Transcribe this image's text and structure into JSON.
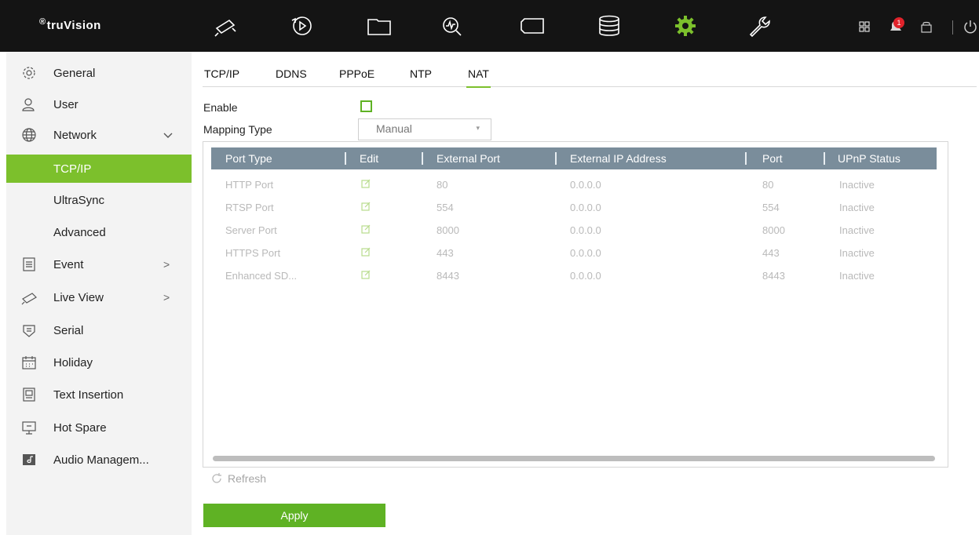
{
  "colors": {
    "topbar_bg": "#141414",
    "accent_green": "#7cc02c",
    "header_row_bg": "#7a8d9b",
    "sidebar_bg": "#f3f3f3",
    "notification_badge": "#e0232b"
  },
  "header": {
    "logo_text": "truVision",
    "nav_icons": [
      "camera-icon",
      "playback-icon",
      "folder-icon",
      "search-analytics-icon",
      "video-tag-icon",
      "database-icon",
      "settings-gear-icon",
      "wrench-icon"
    ],
    "active_icon": "settings-gear-icon",
    "notification_count": "1",
    "right_icons": [
      "grid-icon",
      "bell-icon",
      "lock-icon",
      "power-icon"
    ]
  },
  "sidebar": {
    "items": [
      {
        "label": "General",
        "icon": "gear-icon"
      },
      {
        "label": "User",
        "icon": "user-icon"
      },
      {
        "label": "Network",
        "icon": "globe-icon",
        "expanded": true
      },
      {
        "label": "TCP/IP",
        "sub": true,
        "active": true
      },
      {
        "label": "UltraSync",
        "sub": true
      },
      {
        "label": "Advanced",
        "sub": true
      },
      {
        "label": "Event",
        "icon": "event-list-icon",
        "chevron": ">"
      },
      {
        "label": "Live View",
        "icon": "camera-icon",
        "chevron": ">"
      },
      {
        "label": "Serial",
        "icon": "serial-icon"
      },
      {
        "label": "Holiday",
        "icon": "calendar-icon"
      },
      {
        "label": "Text Insertion",
        "icon": "text-insertion-icon"
      },
      {
        "label": "Hot Spare",
        "icon": "hot-spare-icon"
      },
      {
        "label": "Audio Managem...",
        "icon": "audio-icon"
      }
    ]
  },
  "tabs": [
    "TCP/IP",
    "DDNS",
    "PPPoE",
    "NTP",
    "NAT"
  ],
  "active_tab": "NAT",
  "form": {
    "enable_label": "Enable",
    "enable_checked": false,
    "mapping_type_label": "Mapping Type",
    "mapping_type_value": "Manual"
  },
  "table": {
    "columns": [
      "Port Type",
      "Edit",
      "External Port",
      "External IP Address",
      "Port",
      "UPnP Status"
    ],
    "rows": [
      {
        "port_type": "HTTP Port",
        "external_port": "80",
        "external_ip": "0.0.0.0",
        "port": "80",
        "status": "Inactive"
      },
      {
        "port_type": "RTSP Port",
        "external_port": "554",
        "external_ip": "0.0.0.0",
        "port": "554",
        "status": "Inactive"
      },
      {
        "port_type": "Server Port",
        "external_port": "8000",
        "external_ip": "0.0.0.0",
        "port": "8000",
        "status": "Inactive"
      },
      {
        "port_type": "HTTPS Port",
        "external_port": "443",
        "external_ip": "0.0.0.0",
        "port": "443",
        "status": "Inactive"
      },
      {
        "port_type": "Enhanced SD...",
        "external_port": "8443",
        "external_ip": "0.0.0.0",
        "port": "8443",
        "status": "Inactive"
      }
    ]
  },
  "actions": {
    "refresh_label": "Refresh",
    "apply_label": "Apply"
  }
}
